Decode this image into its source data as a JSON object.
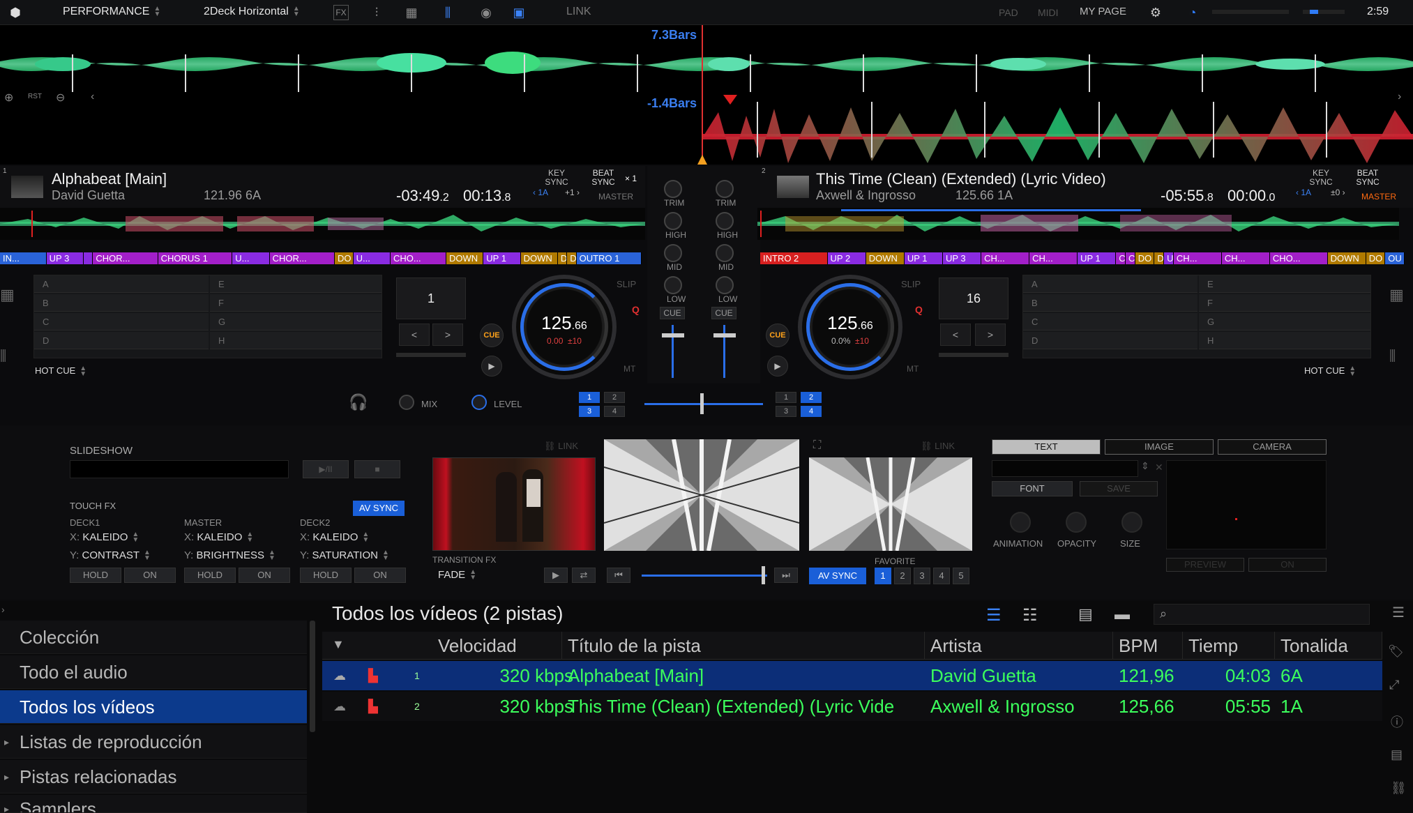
{
  "topbar": {
    "mode": "PERFORMANCE",
    "layout": "2Deck Horizontal",
    "link": "LINK",
    "pad": "PAD",
    "midi": "MIDI",
    "my_page": "MY PAGE",
    "clock": "2:59",
    "icons": [
      "logo-icon",
      "fx-icon",
      "sampler-icon",
      "grid-icon",
      "mixer-icon",
      "record-icon",
      "video-icon"
    ]
  },
  "overview": {
    "upper_marker": "7.3Bars",
    "lower_marker": "-1.4Bars",
    "rst": "RST"
  },
  "deck1": {
    "number": "1",
    "title": "Alphabeat [Main]",
    "artist": "David Guetta",
    "bpm_key": "121.96 6A",
    "remaining": "-03:49",
    "remaining_frac": ".2",
    "elapsed": "00:13",
    "elapsed_frac": ".8",
    "key_sync": "KEY SYNC",
    "key_val": "1A",
    "key_shift": "+1",
    "beat_sync": "BEAT SYNC",
    "multiplier": "× 1",
    "master": "MASTER",
    "cue_segments": [
      {
        "label": "IN...",
        "color": "#2a63d8"
      },
      {
        "label": "UP 3",
        "color": "#8a2be2"
      },
      {
        "label": "",
        "color": "#8a2be2"
      },
      {
        "label": "CHOR...",
        "color": "#a31fc9"
      },
      {
        "label": "CHORUS 1",
        "color": "#a31fc9"
      },
      {
        "label": "U...",
        "color": "#8a2be2"
      },
      {
        "label": "CHOR...",
        "color": "#a31fc9"
      },
      {
        "label": "DO",
        "color": "#b07a00"
      },
      {
        "label": "U...",
        "color": "#8a2be2"
      },
      {
        "label": "CHO...",
        "color": "#a31fc9"
      },
      {
        "label": "DOWN",
        "color": "#b07a00"
      },
      {
        "label": "UP 1",
        "color": "#8a2be2"
      },
      {
        "label": "DOWN",
        "color": "#b07a00"
      },
      {
        "label": "D",
        "color": "#b07a00"
      },
      {
        "label": "D",
        "color": "#b07a00"
      },
      {
        "label": "OUTRO 1",
        "color": "#2a63d8"
      }
    ],
    "pads_left": [
      "A",
      "B",
      "C",
      "D"
    ],
    "pads_right": [
      "E",
      "F",
      "G",
      "H"
    ],
    "loop_value": "1",
    "bpm": "125",
    "bpm_frac": ".66",
    "pitch": "0.00",
    "range": "±10",
    "cue": "CUE",
    "slip": "SLIP",
    "q": "Q",
    "mt": "MT",
    "hot_cue": "HOT CUE"
  },
  "deck2": {
    "number": "2",
    "title": "This Time (Clean) (Extended) (Lyric Video)",
    "artist": "Axwell & Ingrosso",
    "bpm_key": "125.66 1A",
    "remaining": "-05:55",
    "remaining_frac": ".8",
    "elapsed": "00:00",
    "elapsed_frac": ".0",
    "key_sync": "KEY SYNC",
    "key_val": "1A",
    "key_shift": "±0",
    "beat_sync": "BEAT SYNC",
    "master": "MASTER",
    "cue_segments": [
      {
        "label": "INTRO 2",
        "color": "#d82020"
      },
      {
        "label": "UP 2",
        "color": "#8a2be2"
      },
      {
        "label": "DOWN",
        "color": "#b07a00"
      },
      {
        "label": "UP 1",
        "color": "#8a2be2"
      },
      {
        "label": "UP 3",
        "color": "#8a2be2"
      },
      {
        "label": "CH...",
        "color": "#a31fc9"
      },
      {
        "label": "CH...",
        "color": "#a31fc9"
      },
      {
        "label": "UP 1",
        "color": "#8a2be2"
      },
      {
        "label": "C",
        "color": "#a31fc9"
      },
      {
        "label": "C",
        "color": "#a31fc9"
      },
      {
        "label": "DO",
        "color": "#b07a00"
      },
      {
        "label": "D",
        "color": "#b07a00"
      },
      {
        "label": "U",
        "color": "#8a2be2"
      },
      {
        "label": "CH...",
        "color": "#a31fc9"
      },
      {
        "label": "CH...",
        "color": "#a31fc9"
      },
      {
        "label": "CHO...",
        "color": "#a31fc9"
      },
      {
        "label": "DOWN",
        "color": "#b07a00"
      },
      {
        "label": "DO",
        "color": "#b07a00"
      },
      {
        "label": "OU",
        "color": "#2a63d8"
      }
    ],
    "pads_left": [
      "A",
      "B",
      "C",
      "D"
    ],
    "pads_right": [
      "E",
      "F",
      "G",
      "H"
    ],
    "loop_value": "16",
    "bpm": "125",
    "bpm_frac": ".66",
    "pitch": "0.0%",
    "range": "±10",
    "cue": "CUE",
    "slip": "SLIP",
    "q": "Q",
    "mt": "MT",
    "hot_cue": "HOT CUE"
  },
  "mixer": {
    "trim": "TRIM",
    "high": "HIGH",
    "mid": "MID",
    "low": "LOW",
    "cue": "CUE",
    "mix": "MIX",
    "level": "LEVEL",
    "assign_left": [
      "1",
      "2",
      "3",
      "4"
    ],
    "assign_right": [
      "1",
      "2",
      "3",
      "4"
    ],
    "crossfader_level": 0.5
  },
  "video": {
    "slideshow": "SLIDESHOW",
    "play_pause": "▶/II",
    "stop": "■",
    "touch_fx": "TOUCH FX",
    "av_sync": "AV SYNC",
    "deck1_label": "DECK1",
    "master_label": "MASTER",
    "deck2_label": "DECK2",
    "x1": "KALEIDO",
    "y1": "CONTRAST",
    "xm": "KALEIDO",
    "ym": "BRIGHTNESS",
    "x2": "KALEIDO",
    "y2": "SATURATION",
    "x": "X:",
    "y": "Y:",
    "hold": "HOLD",
    "on": "ON",
    "link": "LINK",
    "transition_fx": "TRANSITION FX",
    "fade": "FADE",
    "favorite": "FAVORITE",
    "favorites": [
      "1",
      "2",
      "3",
      "4",
      "5"
    ],
    "tabs": [
      "TEXT",
      "IMAGE",
      "CAMERA"
    ],
    "font": "FONT",
    "save": "SAVE",
    "animation": "ANIMATION",
    "opacity": "OPACITY",
    "size": "SIZE",
    "preview": "PREVIEW",
    "preview_on": "ON"
  },
  "browser": {
    "sidebar": [
      "Colección",
      "Todo el audio",
      "Todos los vídeos",
      "Listas de reproducción",
      "Pistas relacionadas",
      "Samplers"
    ],
    "title": "Todos los vídeos (2 pistas)",
    "columns": [
      "Velocidad",
      "Título de la pista",
      "Artista",
      "BPM",
      "Tiemp",
      "Tonalida"
    ],
    "rows": [
      {
        "num": "1",
        "bitrate": "320 kbps",
        "title": "Alphabeat [Main]",
        "artist": "David Guetta",
        "bpm": "121,96",
        "time": "04:03",
        "key": "6A"
      },
      {
        "num": "2",
        "bitrate": "320 kbps",
        "title": "This Time (Clean) (Extended) (Lyric Vide",
        "artist": "Axwell & Ingrosso",
        "bpm": "125,66",
        "time": "05:55",
        "key": "1A"
      }
    ]
  }
}
